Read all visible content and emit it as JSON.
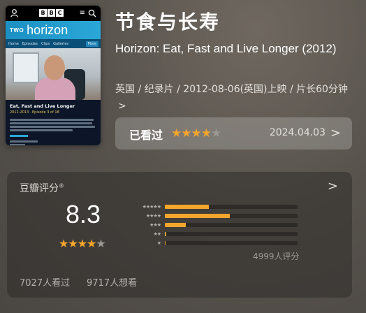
{
  "poster": {
    "channel": "TWO",
    "show": "horizon",
    "nav_items": [
      "Home",
      "Episodes",
      "Clips",
      "Galleries"
    ],
    "nav_more": "More",
    "episode_title": "Eat, Fast and Live Longer",
    "episode_sub": "2012-2013 · Episode 3 of 18",
    "brand_letters": [
      "B",
      "B",
      "C"
    ]
  },
  "title_zh": "节食与长寿",
  "title_en": "Horizon: Eat, Fast and Live Longer (2012)",
  "meta": "英国 / 纪录片 / 2012-08-06(英国)上映 / 片长60分钟",
  "meta_chevron": ">",
  "watched": {
    "label": "已看过",
    "stars": 4,
    "max_stars": 5,
    "date": "2024.04.03",
    "arrow": ">"
  },
  "rating": {
    "title": "豆瓣评分",
    "mark": "®",
    "arrow": ">",
    "score": "8.3",
    "stars": 4,
    "max_stars": 5,
    "distribution": [
      {
        "label": "★★★★★",
        "value": 0.33
      },
      {
        "label": "★★★★",
        "value": 0.49
      },
      {
        "label": "★★★",
        "value": 0.16
      },
      {
        "label": "★★",
        "value": 0.01
      },
      {
        "label": "★",
        "value": 0.005
      }
    ],
    "count_text": "4999人评分",
    "watched_text": "7027人看过",
    "want_text": "9717人想看"
  },
  "colors": {
    "accent": "#f3a52c",
    "star_off": "#9b9894",
    "poster_blue": "#1c8fc2"
  }
}
